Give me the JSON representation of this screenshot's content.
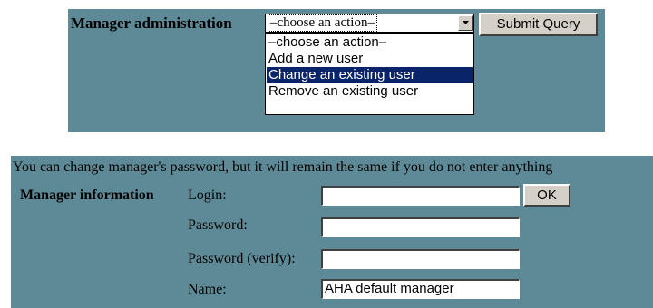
{
  "manager_admin": {
    "label": "Manager administration",
    "select": {
      "current_value": "–choose an action–",
      "options": [
        "–choose an action–",
        "Add a new user",
        "Change an existing user",
        "Remove an existing user"
      ],
      "highlighted_index": 2
    },
    "submit_label": "Submit Query"
  },
  "manager_info": {
    "help_text": "You can change manager's password, but it will remain the same if you do not enter anything",
    "section_label": "Manager information",
    "fields": {
      "login": {
        "label": "Login:",
        "value": ""
      },
      "password": {
        "label": "Password:",
        "value": ""
      },
      "password_verify": {
        "label": "Password (verify):",
        "value": ""
      },
      "name": {
        "label": "Name:",
        "value": "AHA default manager"
      }
    },
    "ok_label": "OK"
  },
  "colors": {
    "panel_background": "#5d8a96",
    "selection_highlight": "#0a246a",
    "button_face": "#d4d0c8"
  },
  "icons": {
    "select_arrow": "chevron-down-icon"
  }
}
